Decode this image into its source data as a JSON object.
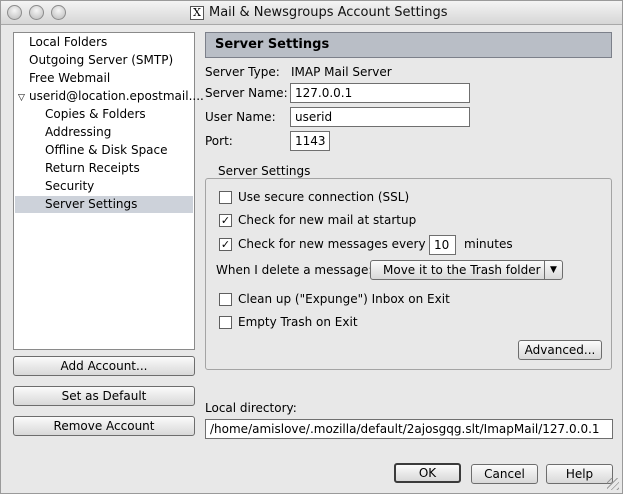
{
  "window": {
    "title": "Mail & Newsgroups Account Settings",
    "title_glyph": "X"
  },
  "tree": {
    "items": [
      {
        "label": "Local Folders"
      },
      {
        "label": "Outgoing Server (SMTP)"
      },
      {
        "label": "Free Webmail"
      },
      {
        "label": "userid@location.epostmail...."
      },
      {
        "label": "Copies & Folders"
      },
      {
        "label": "Addressing"
      },
      {
        "label": "Offline & Disk Space"
      },
      {
        "label": "Return Receipts"
      },
      {
        "label": "Security"
      },
      {
        "label": "Server Settings"
      }
    ],
    "selected": "Server Settings"
  },
  "left_buttons": {
    "add_account": "Add Account...",
    "set_default": "Set as Default",
    "remove_account": "Remove Account"
  },
  "panel": {
    "header": "Server Settings",
    "server_type_label": "Server Type:",
    "server_type_value": "IMAP Mail Server",
    "server_name_label": "Server Name:",
    "server_name_value": "127.0.0.1",
    "user_name_label": "User Name:",
    "user_name_value": "userid",
    "port_label": "Port:",
    "port_value": "1143"
  },
  "group": {
    "title": "Server Settings",
    "ssl_label": "Use secure connection (SSL)",
    "ssl_checked": false,
    "startup_label": "Check for new mail at startup",
    "startup_checked": true,
    "every_label": "Check for new messages every",
    "every_checked": true,
    "every_value": "10",
    "minutes_label": "minutes",
    "delete_label": "When I delete a message:",
    "delete_value": "Move it to the Trash folder",
    "expunge_label": "Clean up (\"Expunge\") Inbox on Exit",
    "expunge_checked": false,
    "empty_trash_label": "Empty Trash on Exit",
    "empty_trash_checked": false,
    "advanced_button": "Advanced..."
  },
  "local_dir": {
    "label": "Local directory:",
    "value": "/home/amislove/.mozilla/default/2ajosgqg.slt/ImapMail/127.0.0.1"
  },
  "footer": {
    "ok": "OK",
    "cancel": "Cancel",
    "help": "Help"
  },
  "icons": {
    "checkmark": "✓",
    "triangle_down": "▼",
    "twisty_open": "▽"
  }
}
